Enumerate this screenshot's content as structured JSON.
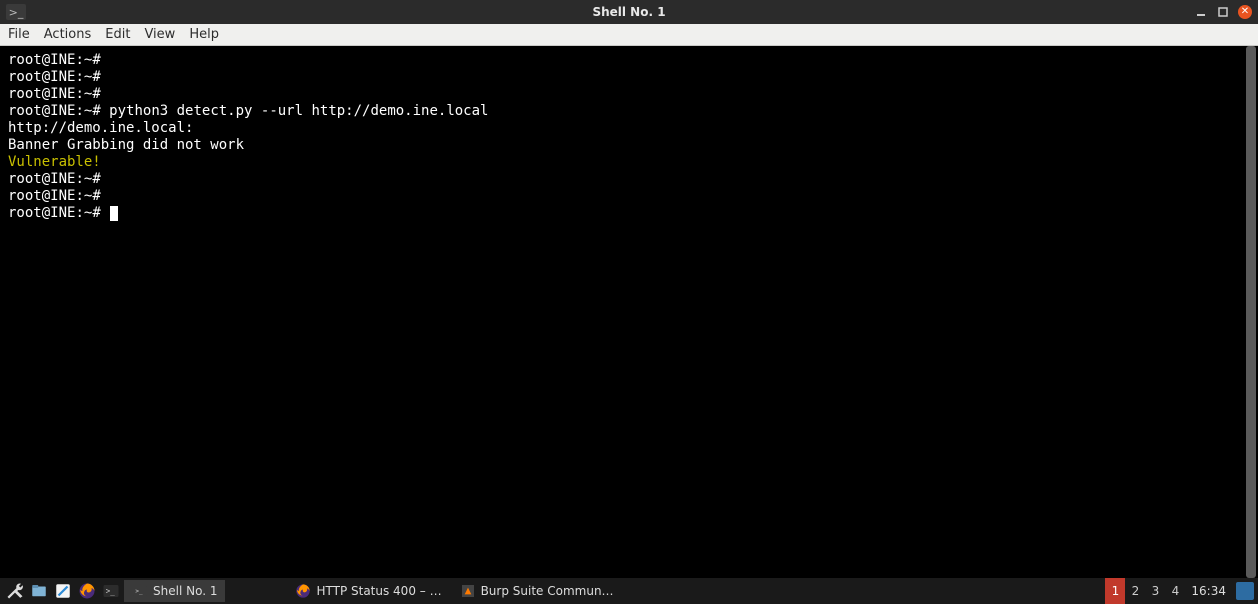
{
  "titlebar": {
    "title": "Shell No. 1"
  },
  "menubar": {
    "file": "File",
    "actions": "Actions",
    "edit": "Edit",
    "view": "View",
    "help": "Help"
  },
  "terminal": {
    "prompt_user": "root@INE",
    "prompt_path": "~",
    "command": "python3 detect.py --url http://demo.ine.local",
    "out1": "http://demo.ine.local:",
    "out2": "Banner Grabbing did not work",
    "vuln": "Vulnerable!"
  },
  "taskbar": {
    "tasks": [
      {
        "label": "Shell No. 1"
      },
      {
        "label": "HTTP Status 400 – …"
      },
      {
        "label": "Burp Suite Commun…"
      }
    ],
    "workspaces": [
      "1",
      "2",
      "3",
      "4"
    ],
    "clock": "16:34"
  }
}
